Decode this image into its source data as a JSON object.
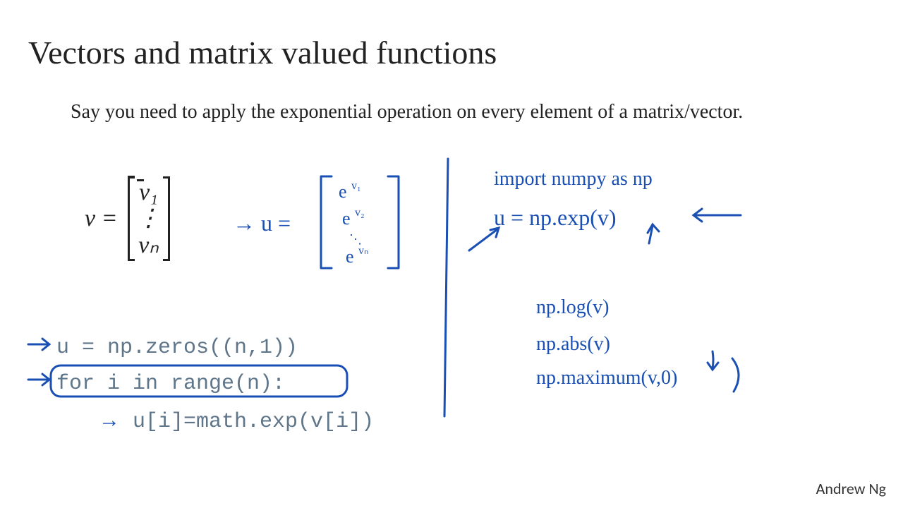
{
  "title": "Vectors and matrix valued functions",
  "subtitle": "Say you need to apply the exponential operation on every element of a matrix/vector.",
  "vector": {
    "lhs": "v =",
    "rows": [
      "v₁",
      "⋮",
      "vₙ"
    ]
  },
  "hw_u_label": "→  u =",
  "hw_u_rows": [
    "eᵛ¹",
    "eᵛ²",
    "⋱",
    "eᵛⁿ"
  ],
  "code": {
    "line1": "u = np.zeros((n,1))",
    "line2": "for i in range(n):",
    "line3": "u[i]=math.exp(v[i])"
  },
  "code_arrows": "→",
  "right": {
    "l1": "import  numpy  as  np",
    "l2": "u = np.exp(v)",
    "l3": "np.log(v)",
    "l4": "np.abs(v)",
    "l5": "np.maximum(v,0)"
  },
  "author": "Andrew Ng"
}
